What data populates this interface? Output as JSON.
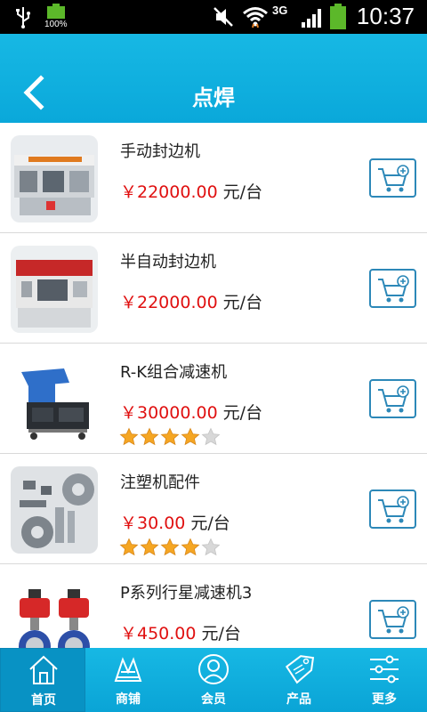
{
  "status_bar": {
    "battery_percent": "100%",
    "network": "3G",
    "time": "10:37"
  },
  "header": {
    "title": "点焊"
  },
  "products": [
    {
      "name": "手动封边机",
      "price": "￥22000.00",
      "unit": "元/台",
      "rating": null,
      "thumb": "edge-banding-machine"
    },
    {
      "name": "半自动封边机",
      "price": "￥22000.00",
      "unit": "元/台",
      "rating": null,
      "thumb": "semi-auto-edge-banding-machine"
    },
    {
      "name": "R-K组合减速机",
      "price": "￥30000.00",
      "unit": "元/台",
      "rating": 4,
      "thumb": "crusher-machine"
    },
    {
      "name": "注塑机配件",
      "price": "￥30.00",
      "unit": "元/台",
      "rating": 4,
      "thumb": "metal-parts"
    },
    {
      "name": "P系列行星减速机3",
      "price": "￥450.00",
      "unit": "元/台",
      "rating": null,
      "thumb": "valve-actuator"
    }
  ],
  "bottom_nav": [
    {
      "label": "首页",
      "icon": "home-icon",
      "active": true
    },
    {
      "label": "商铺",
      "icon": "shop-icon",
      "active": false
    },
    {
      "label": "会员",
      "icon": "member-icon",
      "active": false
    },
    {
      "label": "产品",
      "icon": "sale-tag-icon",
      "active": false
    },
    {
      "label": "更多",
      "icon": "sliders-icon",
      "active": false
    }
  ],
  "colors": {
    "accent": "#0aa8da",
    "price": "#e01010",
    "cart_border": "#2c88b8",
    "star_filled": "#f5a623",
    "star_empty": "#d8d8d8"
  }
}
